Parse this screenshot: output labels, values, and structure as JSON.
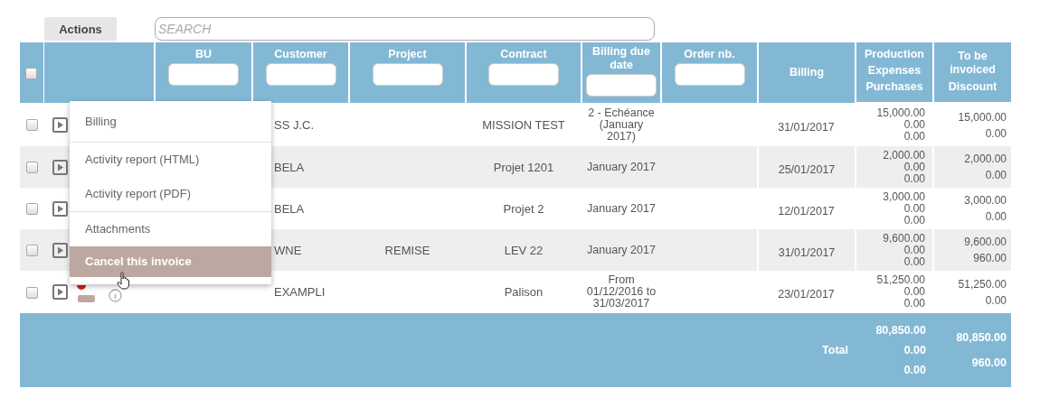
{
  "toolbar": {
    "actions_button": "Actions",
    "search": {
      "placeholder": "SEARCH"
    }
  },
  "table": {
    "select_all": {
      "checked": false
    },
    "columns": [
      {
        "lines": [
          "BU"
        ],
        "filter": true
      },
      {
        "lines": [
          "Customer"
        ],
        "filter": true
      },
      {
        "lines": [
          "Project"
        ],
        "filter": true
      },
      {
        "lines": [
          "Contract"
        ],
        "filter": true
      },
      {
        "lines": [
          "Billing due date"
        ],
        "filter": true
      },
      {
        "lines": [
          "Order nb."
        ],
        "filter": true
      },
      {
        "lines": [
          "Billing"
        ],
        "filter": false
      },
      {
        "lines": [
          "Production",
          "Expenses",
          "Purchases"
        ],
        "filter": false
      },
      {
        "lines": [
          "To be invoiced",
          "Discount"
        ],
        "filter": false
      }
    ],
    "rows": [
      {
        "checked": false,
        "alert": false,
        "customer": "SS J.C.",
        "contract": "MISSION TEST",
        "due": "2 - Echéance (January 2017)",
        "billing": "31/01/2017",
        "production": [
          "15,000.00",
          "0.00",
          "0.00"
        ],
        "invoiced": [
          "15,000.00",
          "0.00"
        ]
      },
      {
        "checked": false,
        "alert": false,
        "customer": "BELA",
        "contract": "Projet 1201",
        "due": "January 2017",
        "billing": "25/01/2017",
        "production": [
          "2,000.00",
          "0.00",
          "0.00"
        ],
        "invoiced": [
          "2,000.00",
          "0.00"
        ]
      },
      {
        "checked": false,
        "alert": false,
        "customer": "BELA",
        "contract": "Projet 2",
        "due": "January 2017",
        "billing": "12/01/2017",
        "production": [
          "3,000.00",
          "0.00",
          "0.00"
        ],
        "invoiced": [
          "3,000.00",
          "0.00"
        ]
      },
      {
        "checked": false,
        "alert": false,
        "customer": "WNE",
        "project": "REMISE",
        "contract": "LEV 22",
        "due": "January 2017",
        "billing": "31/01/2017",
        "production": [
          "9,600.00",
          "0.00",
          "0.00"
        ],
        "invoiced": [
          "9,600.00",
          "960.00"
        ]
      },
      {
        "checked": false,
        "alert": true,
        "customer": "EXAMPLI",
        "contract": "Palison",
        "due": "From 01/12/2016 to 31/03/2017",
        "billing": "23/01/2017",
        "production": [
          "51,250.00",
          "0.00",
          "0.00"
        ],
        "invoiced": [
          "51,250.00",
          "0.00"
        ]
      }
    ],
    "footer": {
      "label": "Total",
      "production": [
        "80,850.00",
        "0.00",
        "0.00"
      ],
      "invoiced": [
        "80,850.00",
        "960.00"
      ]
    }
  },
  "context_menu": {
    "groups": [
      [
        {
          "label": "Billing",
          "selected": false
        }
      ],
      [
        {
          "label": "Activity report (HTML)",
          "selected": false
        },
        {
          "label": "Activity report (PDF)",
          "selected": false
        }
      ],
      [
        {
          "label": "Attachments",
          "selected": false
        },
        {
          "label": "Cancel this invoice",
          "selected": true
        }
      ]
    ]
  }
}
